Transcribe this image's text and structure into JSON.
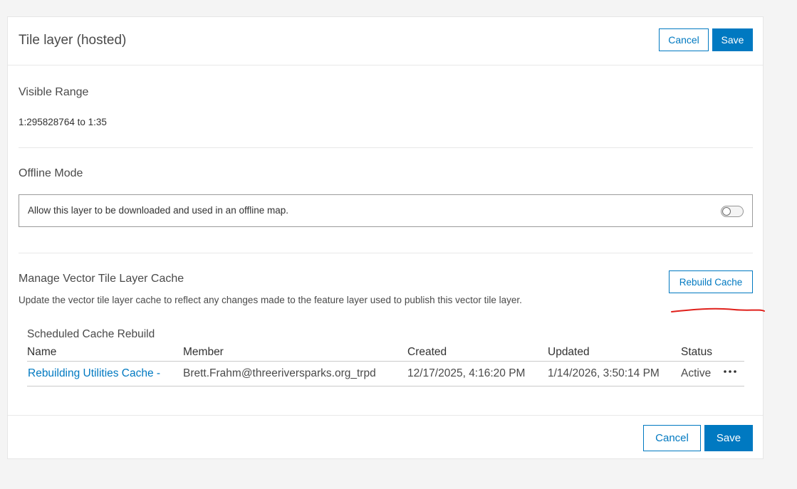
{
  "header": {
    "title": "Tile layer (hosted)",
    "cancel_label": "Cancel",
    "save_label": "Save"
  },
  "visible_range": {
    "heading": "Visible Range",
    "value": "1:295828764 to 1:35"
  },
  "offline_mode": {
    "heading": "Offline Mode",
    "label": "Allow this layer to be downloaded and used in an offline map.",
    "enabled": false
  },
  "cache": {
    "heading": "Manage Vector Tile Layer Cache",
    "rebuild_label": "Rebuild Cache",
    "description": "Update the vector tile layer cache to reflect any changes made to the feature layer used to publish this vector tile layer.",
    "annotation_color": "#e0201b"
  },
  "schedule": {
    "title": "Scheduled Cache Rebuild",
    "columns": [
      "Name",
      "Member",
      "Created",
      "Updated",
      "Status"
    ],
    "rows": [
      {
        "name": "Rebuilding Utilities Cache -",
        "member": "Brett.Frahm@threeriversparks.org_trpd",
        "created": "12/17/2025, 4:16:20 PM",
        "updated": "1/14/2026, 3:50:14 PM",
        "status": "Active",
        "menu_icon": "more-horizontal-icon"
      }
    ]
  },
  "footer": {
    "cancel_label": "Cancel",
    "save_label": "Save"
  },
  "colors": {
    "accent": "#0079c1",
    "background": "#f4f4f4",
    "panel": "#ffffff"
  }
}
